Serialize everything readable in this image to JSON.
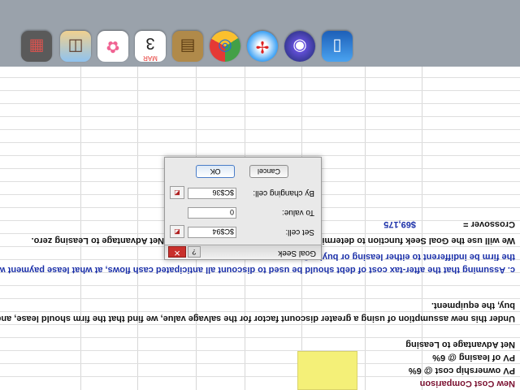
{
  "sheet": {
    "title": "New Cost Comparison",
    "rows": {
      "pv_ownership": "PV ownership cost @ 6%",
      "pv_leasing": "PV of leasing @ 6%",
      "net_advantage": "Net Advantage to Leasing"
    },
    "paragraph_line1": "Under this new assumption of using a greater discount factor for the salvage value, we find that the firm should lease, and no",
    "paragraph_line2": "buy, the equipment.",
    "question_line1": "c.   Assuming that the after-tax cost of debt should be used  to discount all anticipated cash flows, at what lease payment wou",
    "question_line2": "the firm be indifferent to either leasing or buying?",
    "goal_seek_note": "We will use the Goal Seek function to determine the lease payment that makes the Net Advantage to Leasing zero.",
    "crossover_label": "Crossover =",
    "crossover_value": "$69,175"
  },
  "goal_seek": {
    "title": "Goal Seek",
    "help_label": "?",
    "close_label": "✕",
    "set_cell_label": "Set cell:",
    "set_cell_value": "$C$94",
    "to_value_label": "To value:",
    "to_value_value": "0",
    "by_changing_label": "By changing cell:",
    "by_changing_value": "$C$36",
    "ok_label": "OK",
    "cancel_label": "Cancel",
    "ref_icon": "◩"
  },
  "dock": {
    "items": [
      {
        "name": "preview-icon",
        "glyph": "▯"
      },
      {
        "name": "siri-icon",
        "glyph": "◉"
      },
      {
        "name": "safari-icon",
        "glyph": "✢"
      },
      {
        "name": "chrome-icon",
        "glyph": "◎"
      },
      {
        "name": "contacts-icon",
        "glyph": "▤"
      },
      {
        "name": "calendar-icon",
        "glyph": "3"
      },
      {
        "name": "photos-icon",
        "glyph": "✿"
      },
      {
        "name": "photo-booth-icon",
        "glyph": "◫"
      },
      {
        "name": "app-icon",
        "glyph": "▦"
      }
    ],
    "calendar_month": "MAR",
    "calendar_day": "3"
  }
}
